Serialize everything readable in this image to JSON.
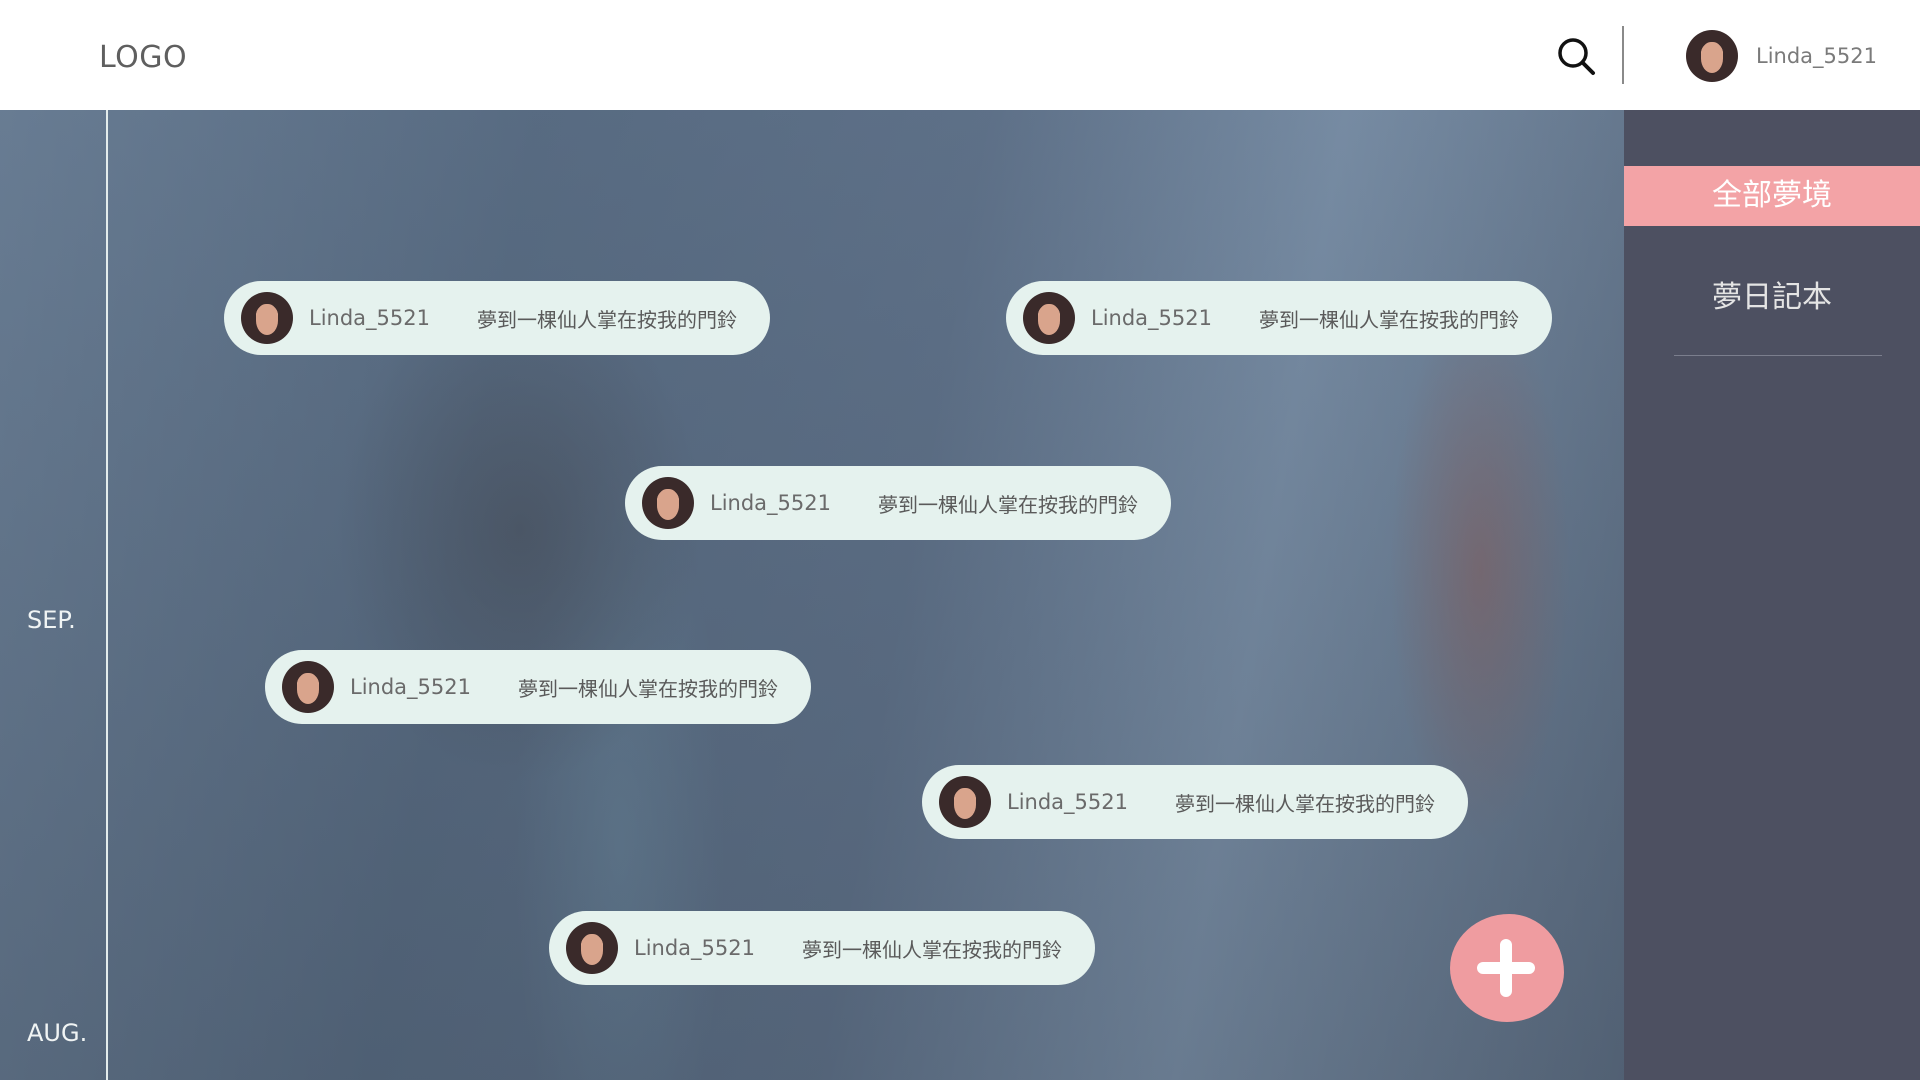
{
  "header": {
    "logo": "LOGO",
    "user_name": "Linda_5521",
    "search_icon": "search-icon"
  },
  "timeline": {
    "months": [
      "SEP.",
      "AUG."
    ]
  },
  "dreams": [
    {
      "user": "Linda_5521",
      "text": "夢到一棵仙人掌在按我的門鈴"
    },
    {
      "user": "Linda_5521",
      "text": "夢到一棵仙人掌在按我的門鈴"
    },
    {
      "user": "Linda_5521",
      "text": "夢到一棵仙人掌在按我的門鈴"
    },
    {
      "user": "Linda_5521",
      "text": "夢到一棵仙人掌在按我的門鈴"
    },
    {
      "user": "Linda_5521",
      "text": "夢到一棵仙人掌在按我的門鈴"
    },
    {
      "user": "Linda_5521",
      "text": "夢到一棵仙人掌在按我的門鈴"
    }
  ],
  "sidebar": {
    "tabs": [
      {
        "label": "全部夢境",
        "active": true
      },
      {
        "label": "夢日記本",
        "active": false
      }
    ]
  },
  "add_button": {
    "icon": "plus-icon"
  },
  "colors": {
    "accent": "#f3a3a6",
    "sidebar_bg": "#4d5061",
    "pill_bg": "#e5f2ee"
  }
}
